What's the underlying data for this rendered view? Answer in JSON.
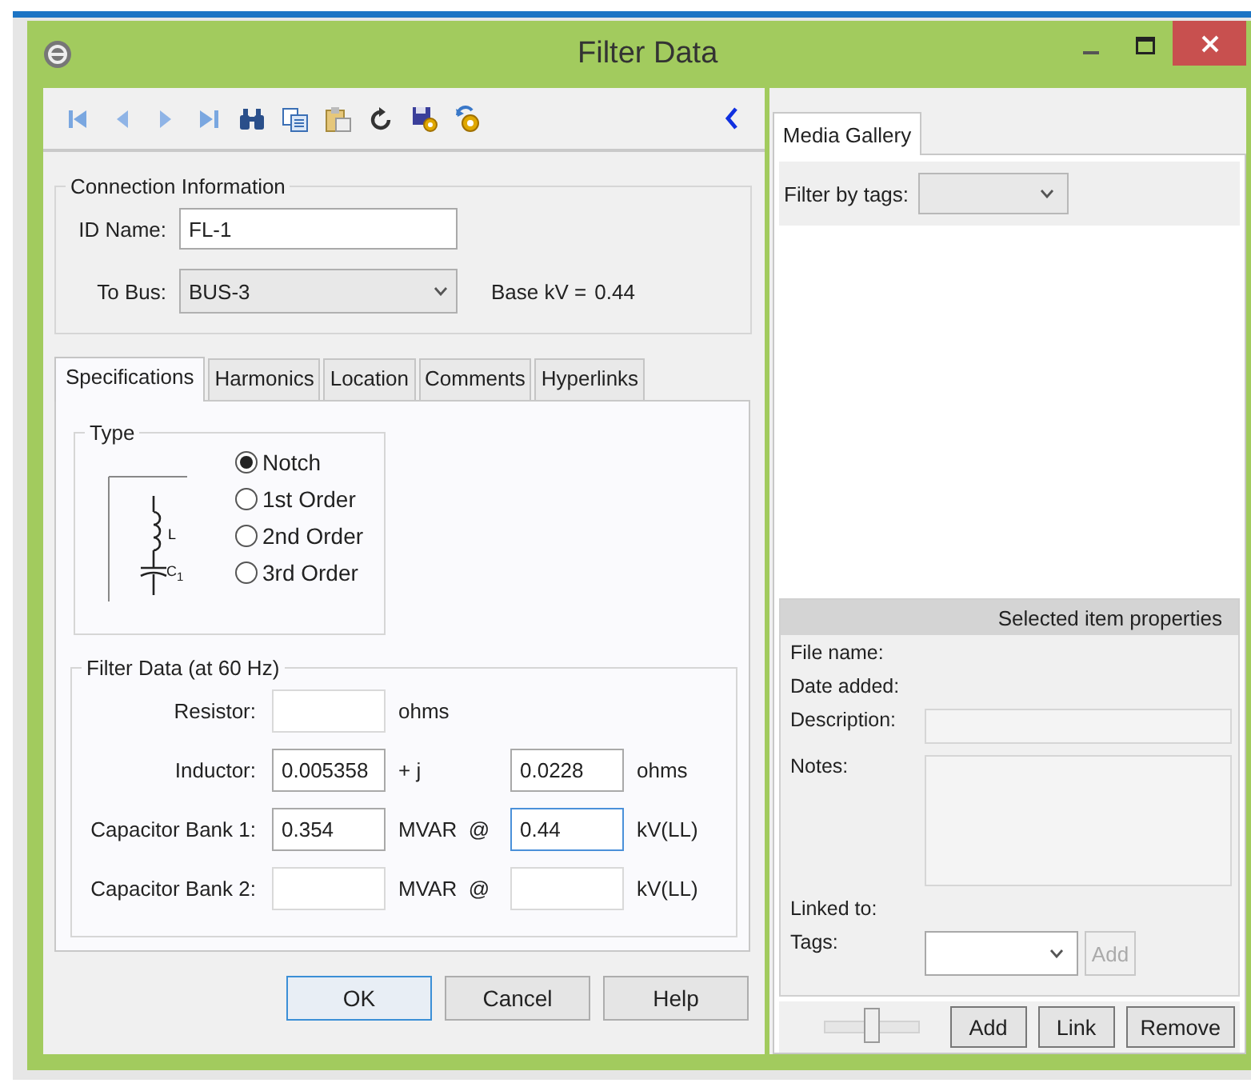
{
  "window": {
    "title": "Filter Data"
  },
  "connection": {
    "title": "Connection Information",
    "id_label": "ID Name:",
    "id_value": "FL-1",
    "bus_label": "To Bus:",
    "bus_value": "BUS-3",
    "base_kv_label": "Base kV =",
    "base_kv_value": "0.44"
  },
  "tabs": [
    {
      "label": "Specifications",
      "selected": true
    },
    {
      "label": "Harmonics",
      "selected": false
    },
    {
      "label": "Location",
      "selected": false
    },
    {
      "label": "Comments",
      "selected": false
    },
    {
      "label": "Hyperlinks",
      "selected": false
    }
  ],
  "type_group": {
    "title": "Type",
    "diagram_labels": [
      "L",
      "C$_{1}$"
    ],
    "options": [
      {
        "label": "Notch",
        "selected": true
      },
      {
        "label": "1st Order",
        "selected": false
      },
      {
        "label": "2nd Order",
        "selected": false
      },
      {
        "label": "3rd Order",
        "selected": false
      }
    ]
  },
  "filter_data": {
    "title": "Filter Data (at 60 Hz)",
    "rows": [
      {
        "label": "Resistor:",
        "cells": [
          {
            "kind": "field",
            "disabled": true,
            "focused": false
          },
          {
            "kind": "text",
            "text": "ohms"
          }
        ]
      },
      {
        "label": "Inductor:",
        "cells": [
          {
            "kind": "field",
            "value": "0.005358",
            "disabled": false,
            "focused": false
          },
          {
            "kind": "text",
            "text": "+ j"
          },
          {
            "kind": "field",
            "value": "0.0228",
            "disabled": false,
            "focused": false
          },
          {
            "kind": "text",
            "text": "ohms"
          }
        ]
      },
      {
        "label": "Capacitor Bank 1:",
        "cells": [
          {
            "kind": "field",
            "value": "0.354",
            "disabled": false,
            "focused": false
          },
          {
            "kind": "text",
            "text": "MVAR  @"
          },
          {
            "kind": "field",
            "value": "0.44",
            "disabled": false,
            "focused": true
          },
          {
            "kind": "text",
            "text": "kV(LL)"
          }
        ]
      },
      {
        "label": "Capacitor Bank 2:",
        "cells": [
          {
            "kind": "field",
            "disabled": true,
            "focused": false
          },
          {
            "kind": "text",
            "text": "MVAR  @"
          },
          {
            "kind": "field",
            "disabled": true,
            "focused": false
          },
          {
            "kind": "text",
            "text": "kV(LL)"
          }
        ]
      }
    ]
  },
  "buttons": [
    {
      "label": "OK",
      "default": true
    },
    {
      "label": "Cancel",
      "default": false
    },
    {
      "label": "Help",
      "default": false
    }
  ],
  "media": {
    "tab": {
      "label": "Media Gallery",
      "selected": true
    },
    "filter_label": "Filter by tags:",
    "properties": {
      "title": "Selected item properties",
      "file_name_label": "File name:",
      "date_added_label": "Date added:",
      "description_label": "Description:",
      "notes_label": "Notes:",
      "linked_to_label": "Linked to:",
      "tags_label": "Tags:",
      "tags_add": {
        "label": "Add",
        "disabled": true
      }
    },
    "slider": {
      "level": 0.5
    },
    "buttons": [
      {
        "label": "Add"
      },
      {
        "label": "Link"
      },
      {
        "label": "Remove"
      }
    ]
  }
}
